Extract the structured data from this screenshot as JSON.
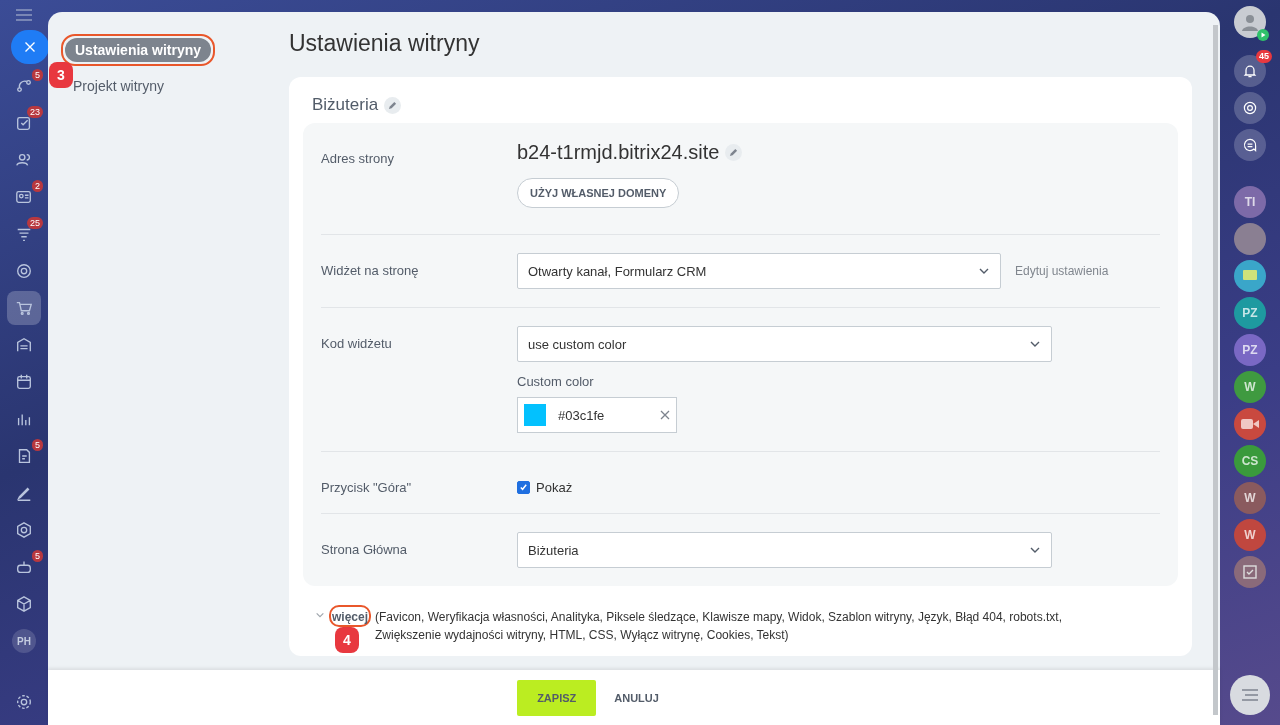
{
  "left_nav": {
    "items": [
      {
        "kind": "close"
      },
      {
        "kind": "flow",
        "badge": "5",
        "selected": false
      },
      {
        "kind": "tasks",
        "badge": "23",
        "selected": false
      },
      {
        "kind": "people",
        "selected": false
      },
      {
        "kind": "card",
        "badge": "2",
        "selected": false
      },
      {
        "kind": "funnel",
        "badge": "25",
        "selected": false
      },
      {
        "kind": "target",
        "selected": false
      },
      {
        "kind": "cart",
        "selected": true
      },
      {
        "kind": "store",
        "selected": false
      },
      {
        "kind": "calendar",
        "selected": false
      },
      {
        "kind": "chart",
        "selected": false
      },
      {
        "kind": "doc",
        "badge": "5",
        "selected": false
      },
      {
        "kind": "sign",
        "selected": false
      },
      {
        "kind": "hexagon",
        "selected": false
      },
      {
        "kind": "robot",
        "badge": "5",
        "selected": false
      },
      {
        "kind": "box",
        "selected": false
      },
      {
        "kind": "initials",
        "text": "PH",
        "selected": false
      }
    ]
  },
  "menu": [
    {
      "label": "Ustawienia witryny",
      "selected": true,
      "callout": "3"
    },
    {
      "label": "Projekt witryny",
      "selected": false
    }
  ],
  "title": "Ustawienia witryny",
  "site_name": "Biżuteria",
  "rows": [
    {
      "kind": "domain",
      "label": "Adres strony",
      "value": "b24-t1rmjd.bitrix24.site",
      "button": "UŻYJ WŁASNEJ DOMENY"
    },
    {
      "kind": "select",
      "label": "Widżet na stronę",
      "value": "Otwarty kanał, Formularz CRM",
      "link": "Edytuj ustawienia"
    },
    {
      "kind": "color_select",
      "label": "Kod widżetu",
      "value": "use custom color",
      "sublabel": "Custom color",
      "color": "#03c1fe",
      "color_text": "#03c1fe"
    },
    {
      "kind": "checkbox",
      "label": "Przycisk \"Góra\"",
      "checked": true,
      "option": "Pokaż"
    },
    {
      "kind": "select",
      "label": "Strona Główna",
      "value": "Biżuteria"
    }
  ],
  "more": {
    "link": "więcej",
    "callout": "4",
    "text": "(Favicon,  Weryfikacja własności,  Analityka,  Piksele śledzące,  Klawisze mapy,  Widok,  Szablon witryny,  Język,  Błąd 404,  robots.txt,  Zwiększenie wydajności witryny,  HTML,  CSS,  Wyłącz witrynę,  Cookies,  Tekst)"
  },
  "footer": {
    "save": "ZAPISZ",
    "cancel": "ANULUJ"
  },
  "right_bar": {
    "items": [
      {
        "kind": "user"
      },
      {
        "kind": "bell",
        "badge": "45"
      },
      {
        "kind": "spiral"
      },
      {
        "kind": "chat"
      },
      {
        "kind": "avatar",
        "text": "TI",
        "color": "#7d6aa8"
      },
      {
        "kind": "photo"
      },
      {
        "kind": "message",
        "color": "#3aa6c9"
      },
      {
        "kind": "avatar",
        "text": "PZ",
        "color": "#1e9aa0"
      },
      {
        "kind": "avatar",
        "text": "PZ",
        "color": "#7a68c4"
      },
      {
        "kind": "avatar",
        "text": "W",
        "color": "#3f9a40"
      },
      {
        "kind": "video",
        "color": "#c9493f"
      },
      {
        "kind": "avatar",
        "text": "CS",
        "color": "#3a9a3c"
      },
      {
        "kind": "avatar",
        "text": "W",
        "color": "#8a5a5e"
      },
      {
        "kind": "avatar",
        "text": "W",
        "color": "#c0473f"
      },
      {
        "kind": "task",
        "color": "#8a6a7a"
      }
    ]
  }
}
